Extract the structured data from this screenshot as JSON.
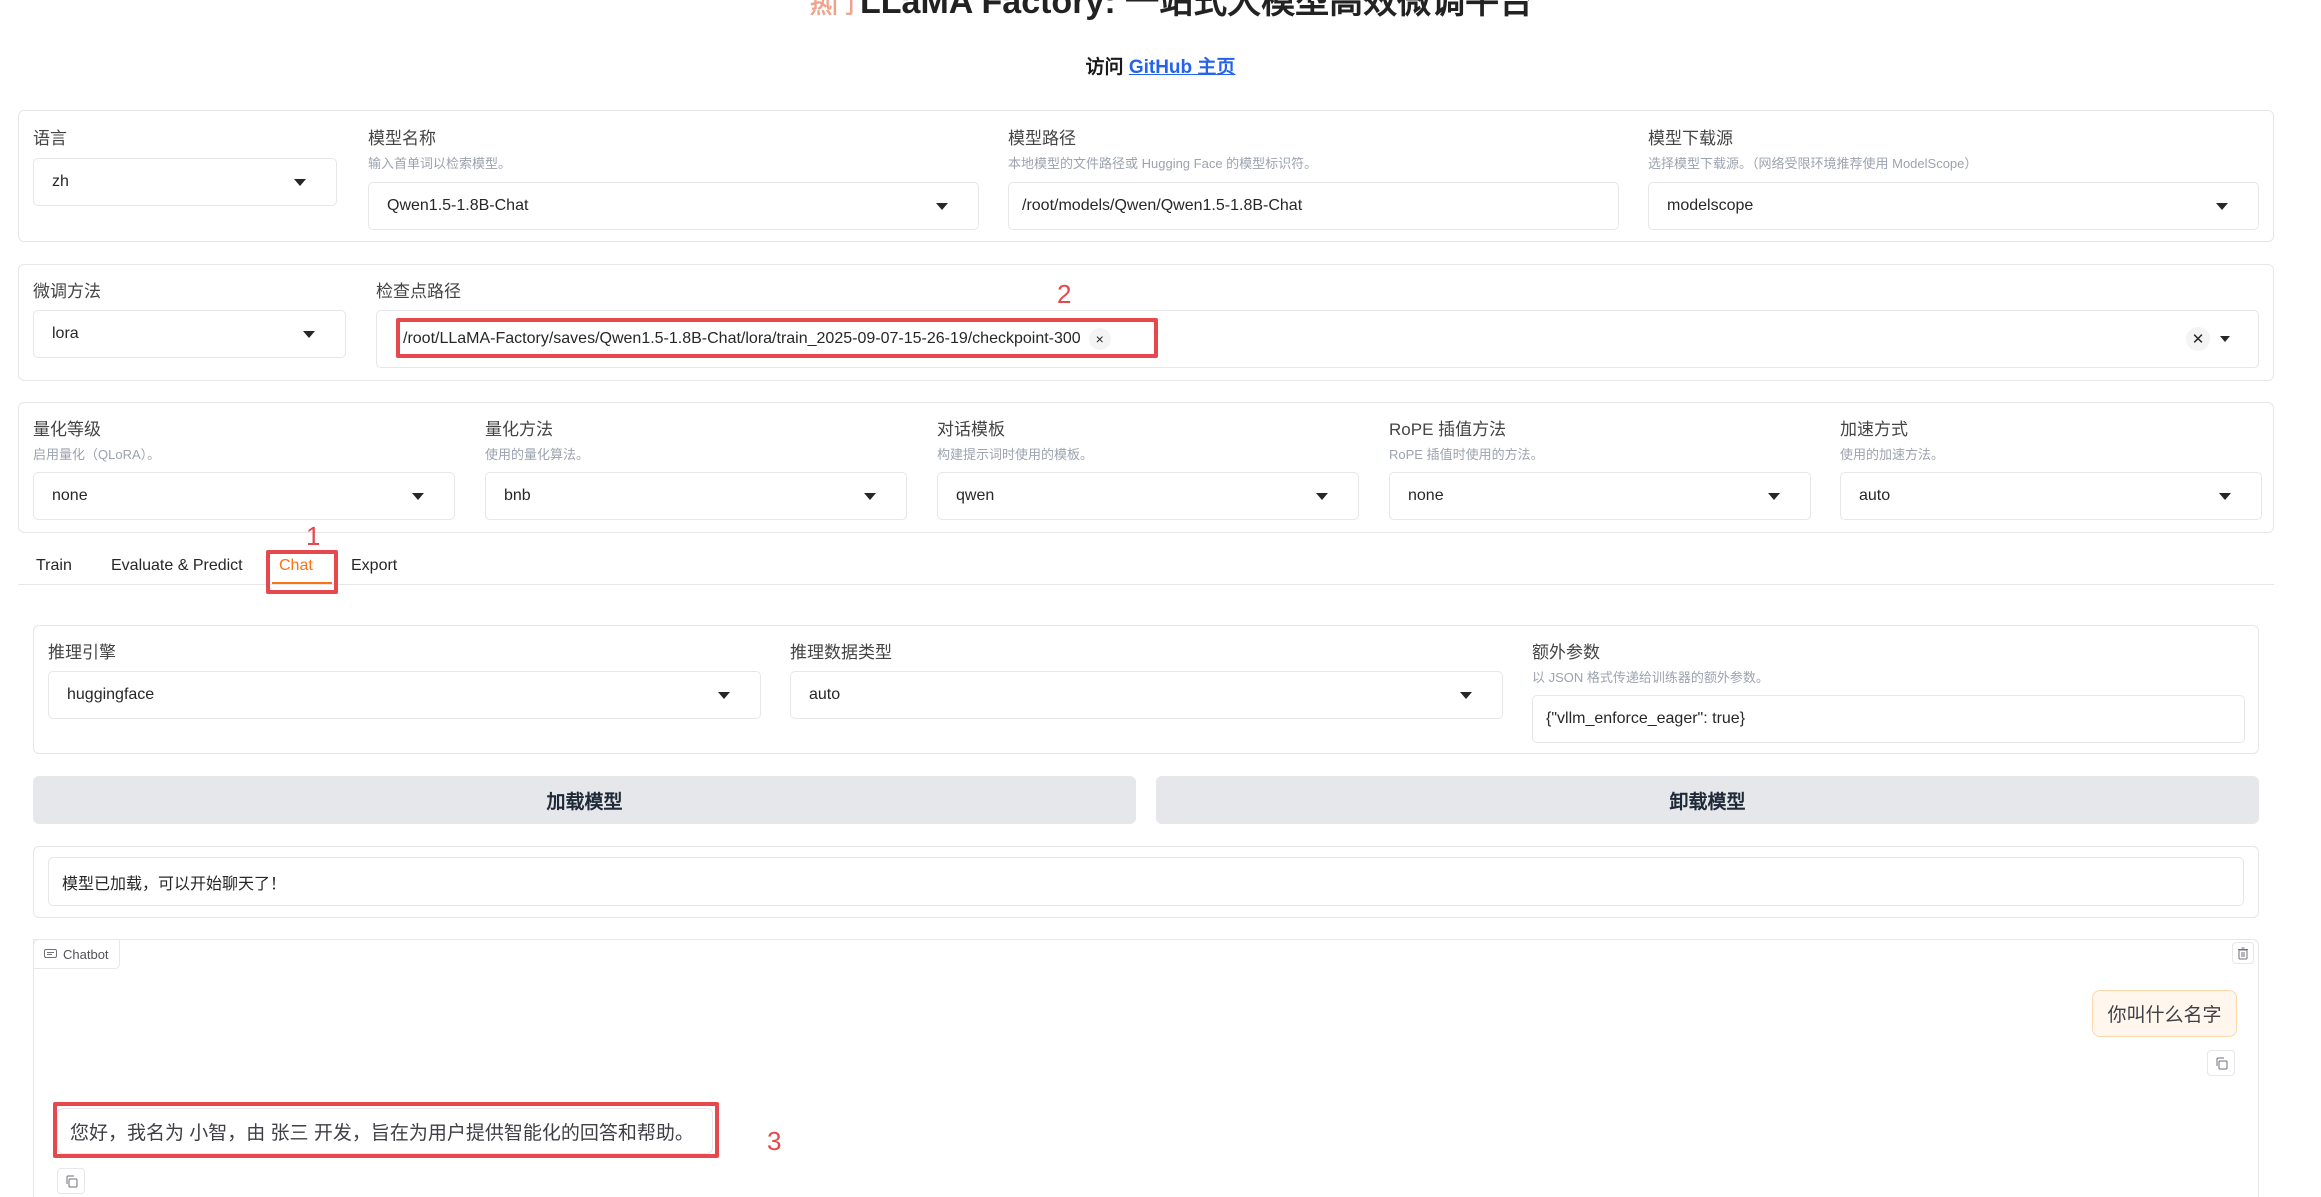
{
  "header": {
    "title_partial": "LLaMA Factory: 一站式大模型高效微调平台",
    "hot_tag": "热门",
    "visit_prefix": "访问 ",
    "visit_link": "GitHub 主页"
  },
  "row1": {
    "lang": {
      "label": "语言",
      "value": "zh"
    },
    "model_name": {
      "label": "模型名称",
      "info": "输入首单词以检索模型。",
      "value": "Qwen1.5-1.8B-Chat"
    },
    "model_path": {
      "label": "模型路径",
      "info": "本地模型的文件路径或 Hugging Face 的模型标识符。",
      "value": "/root/models/Qwen/Qwen1.5-1.8B-Chat"
    },
    "hub": {
      "label": "模型下载源",
      "info": "选择模型下载源。（网络受限环境推荐使用 ModelScope）",
      "value": "modelscope"
    }
  },
  "row2": {
    "finetune": {
      "label": "微调方法",
      "value": "lora"
    },
    "checkpoint": {
      "label": "检查点路径",
      "value": "/root/LLaMA-Factory/saves/Qwen1.5-1.8B-Chat/lora/train_2025-09-07-15-26-19/checkpoint-300",
      "remove": "×",
      "clear": "✕"
    }
  },
  "row3": {
    "quant_bit": {
      "label": "量化等级",
      "info": "启用量化（QLoRA）。",
      "value": "none"
    },
    "quant_method": {
      "label": "量化方法",
      "info": "使用的量化算法。",
      "value": "bnb"
    },
    "template": {
      "label": "对话模板",
      "info": "构建提示词时使用的模板。",
      "value": "qwen"
    },
    "rope": {
      "label": "RoPE 插值方法",
      "info": "RoPE 插值时使用的方法。",
      "value": "none"
    },
    "booster": {
      "label": "加速方式",
      "info": "使用的加速方法。",
      "value": "auto"
    }
  },
  "tabs": [
    "Train",
    "Evaluate & Predict",
    "Chat",
    "Export"
  ],
  "infer": {
    "backend": {
      "label": "推理引擎",
      "value": "huggingface"
    },
    "dtype": {
      "label": "推理数据类型",
      "value": "auto"
    },
    "extra": {
      "label": "额外参数",
      "info": "以 JSON 格式传递给训练器的额外参数。",
      "value": "{\"vllm_enforce_eager\": true}"
    }
  },
  "buttons": {
    "load": "加载模型",
    "unload": "卸载模型"
  },
  "status": "模型已加载，可以开始聊天了！",
  "chat": {
    "label": "Chatbot",
    "user_msg": "你叫什么名字",
    "bot_msg": "您好，我名为 小智，由 张三 开发，旨在为用户提供智能化的回答和帮助。"
  },
  "annotations": [
    "1",
    "2",
    "3"
  ],
  "colors": {
    "accent": "#f97316",
    "annotation": "#e5484d",
    "link": "#2563eb"
  }
}
